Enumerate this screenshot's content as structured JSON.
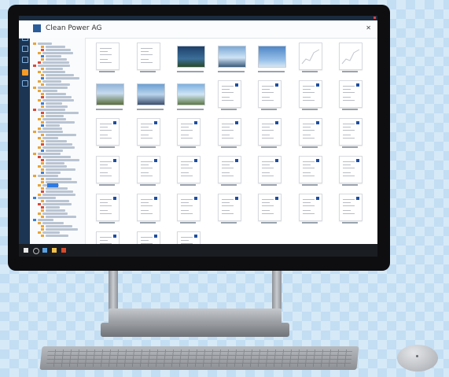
{
  "app": {
    "window_title": "",
    "header_title": "Clean Power AG"
  },
  "icons": {
    "close": "close-icon",
    "app_logo": "app-logo-icon"
  },
  "colors": {
    "rail": "#1c3553",
    "taskbar": "#1a1d22",
    "accent": "#2f7ae0",
    "folder": "#e9a43a"
  },
  "grid": {
    "rows": 6,
    "tiles_per_row": [
      7,
      7,
      7,
      7,
      7,
      3
    ]
  }
}
